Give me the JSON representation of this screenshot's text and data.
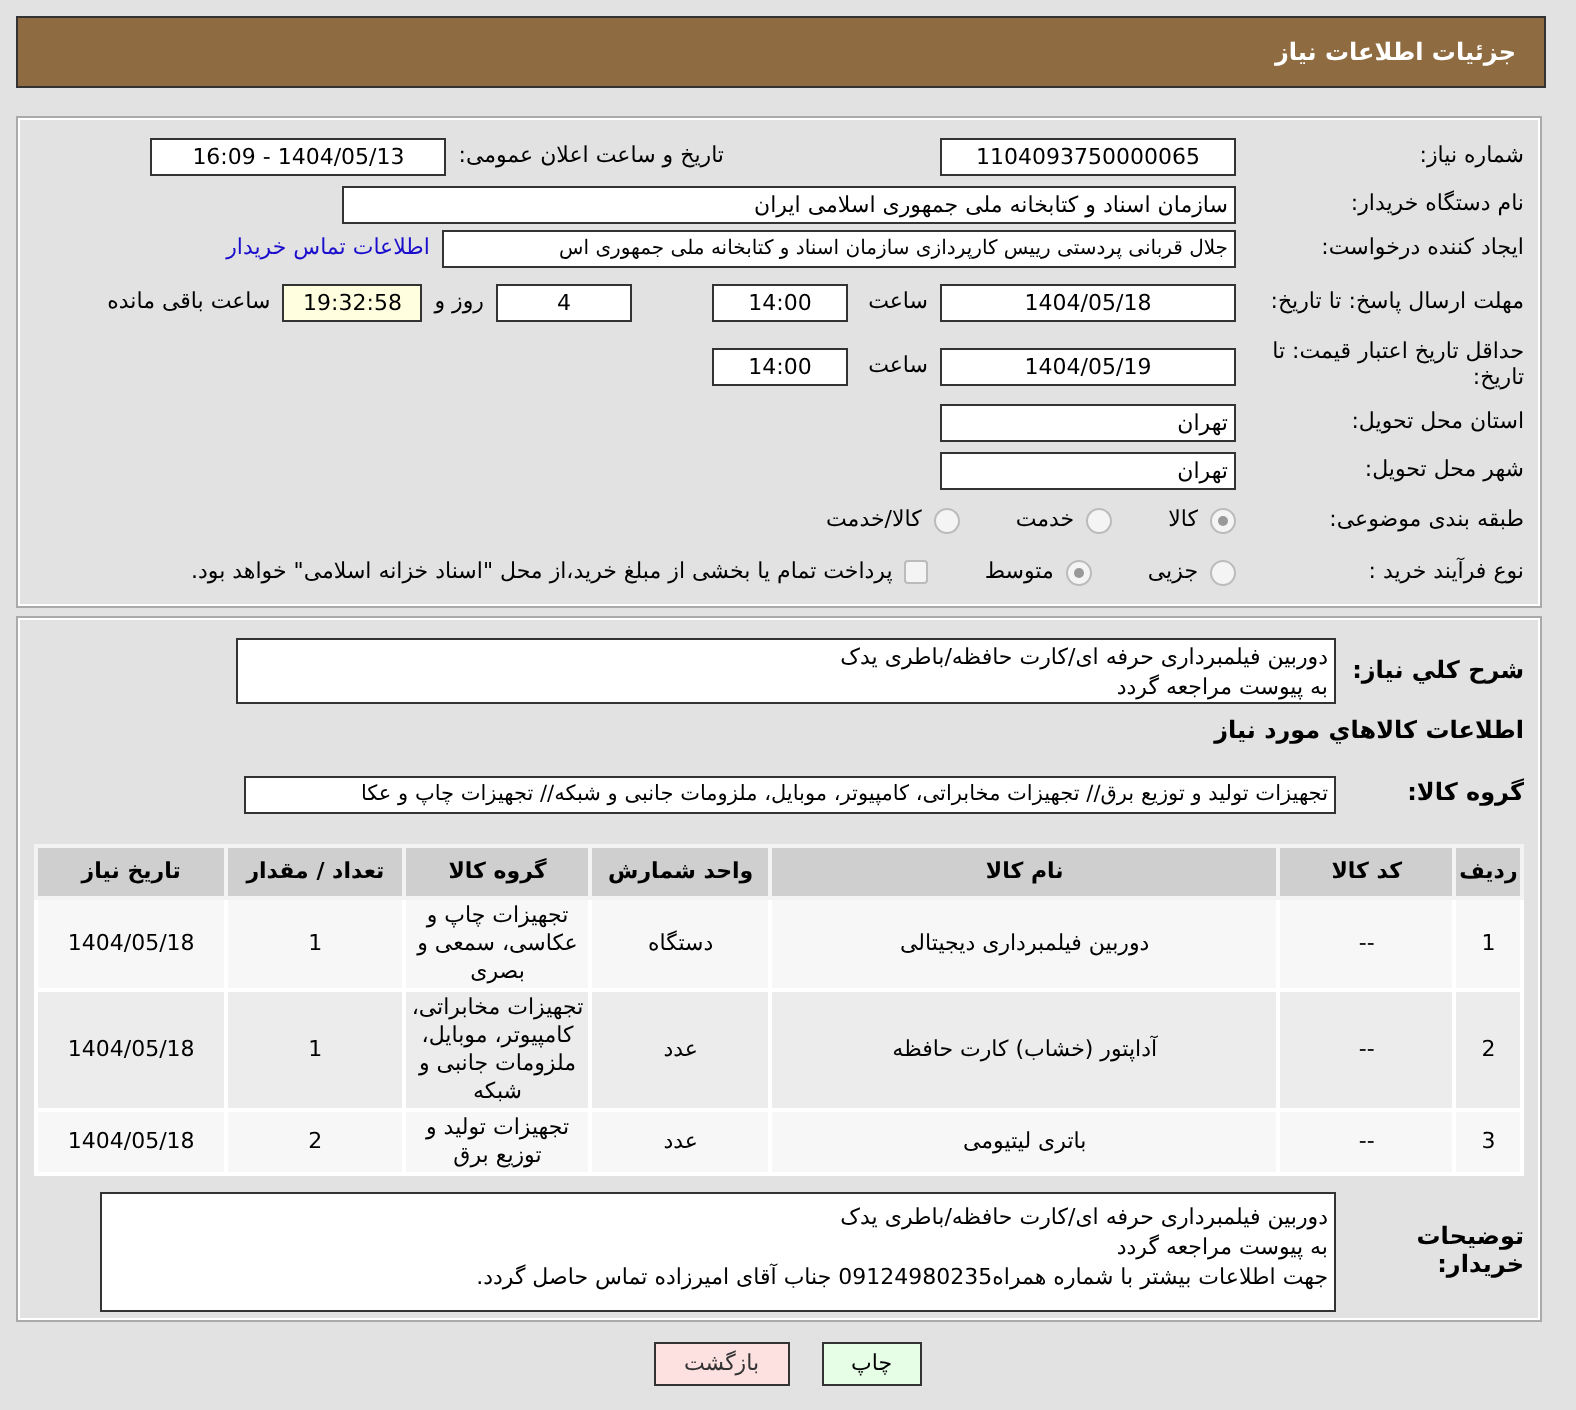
{
  "header": {
    "title": "جزئیات اطلاعات نیاز"
  },
  "need_number": {
    "label": "شماره نیاز:",
    "value": "1104093750000065"
  },
  "announce": {
    "label": "تاریخ و ساعت اعلان عمومی:",
    "value": "1404/05/13 - 16:09"
  },
  "buyer_org": {
    "label": "نام دستگاه خریدار:",
    "value": "سازمان اسناد و کتابخانه ملی جمهوری اسلامی ایران"
  },
  "creator": {
    "label": "ایجاد کننده درخواست:",
    "value": "جلال قربانی پردستی رییس کارپردازی سازمان اسناد و کتابخانه ملی جمهوری اس",
    "link": "اطلاعات تماس خریدار"
  },
  "reply_deadline": {
    "label": "مهلت ارسال پاسخ: تا تاریخ:",
    "date": "1404/05/18",
    "time_label": "ساعت",
    "time": "14:00",
    "days": "4",
    "days_label": "روز و",
    "remaining": "19:32:58",
    "remaining_label": "ساعت باقی مانده"
  },
  "price_validity": {
    "label": "حداقل تاریخ اعتبار قیمت: تا تاریخ:",
    "date": "1404/05/19",
    "time_label": "ساعت",
    "time": "14:00"
  },
  "province": {
    "label": "استان محل تحویل:",
    "value": "تهران"
  },
  "city": {
    "label": "شهر محل تحویل:",
    "value": "تهران"
  },
  "category": {
    "label": "طبقه بندی موضوعی:",
    "options": [
      {
        "label": "کالا",
        "selected": true
      },
      {
        "label": "خدمت",
        "selected": false
      },
      {
        "label": "کالا/خدمت",
        "selected": false
      }
    ]
  },
  "process": {
    "label": "نوع فرآیند خرید :",
    "options": [
      {
        "label": "جزیی",
        "selected": false
      },
      {
        "label": "متوسط",
        "selected": true
      }
    ],
    "treasury": {
      "label": "پرداخت تمام یا بخشی از مبلغ خرید،از محل \"اسناد خزانه اسلامی\" خواهد بود.",
      "checked": false
    }
  },
  "description": {
    "label": "شرح کلي نياز:",
    "lines": [
      "دوربین فیلمبرداری حرفه ای/کارت حافظه/باطری یدک",
      "به پیوست مراجعه گردد"
    ]
  },
  "goods_title": "اطلاعات کالاهاي مورد نياز",
  "goods_group": {
    "label": "گروه کالا:",
    "value": "تجهیزات تولید و توزیع برق// تجهیزات مخابراتی، کامپیوتر، موبایل، ملزومات جانبی و شبکه// تجهیزات چاپ و عکا"
  },
  "table": {
    "columns": [
      "ردیف",
      "کد کالا",
      "نام کالا",
      "واحد شمارش",
      "گروه کالا",
      "تعداد / مقدار",
      "تاریخ نیاز"
    ],
    "rows": [
      [
        "1",
        "--",
        "دوربین فیلمبرداری دیجیتالی",
        "دستگاه",
        "تجهیزات چاپ و عکاسی، سمعی و بصری",
        "1",
        "1404/05/18"
      ],
      [
        "2",
        "--",
        "آداپتور (خشاب) کارت حافظه",
        "عدد",
        "تجهیزات مخابراتی، کامپیوتر، موبایل، ملزومات جانبی و شبکه",
        "1",
        "1404/05/18"
      ],
      [
        "3",
        "--",
        "باتری لیتیومی",
        "عدد",
        "تجهیزات تولید و توزیع برق",
        "2",
        "1404/05/18"
      ]
    ]
  },
  "buyer_notes": {
    "label": "توضیحات خریدار:",
    "lines": [
      "دوربین فیلمبرداری حرفه ای/کارت حافظه/باطری یدک",
      "به پیوست مراجعه گردد",
      "جهت اطلاعات بیشتر با شماره همراه09124980235 جناب آقای امیرزاده تماس حاصل گردد."
    ]
  },
  "buttons": [
    {
      "label": "چاپ",
      "kind": "print"
    },
    {
      "label": "بازگشت",
      "kind": "back"
    }
  ]
}
